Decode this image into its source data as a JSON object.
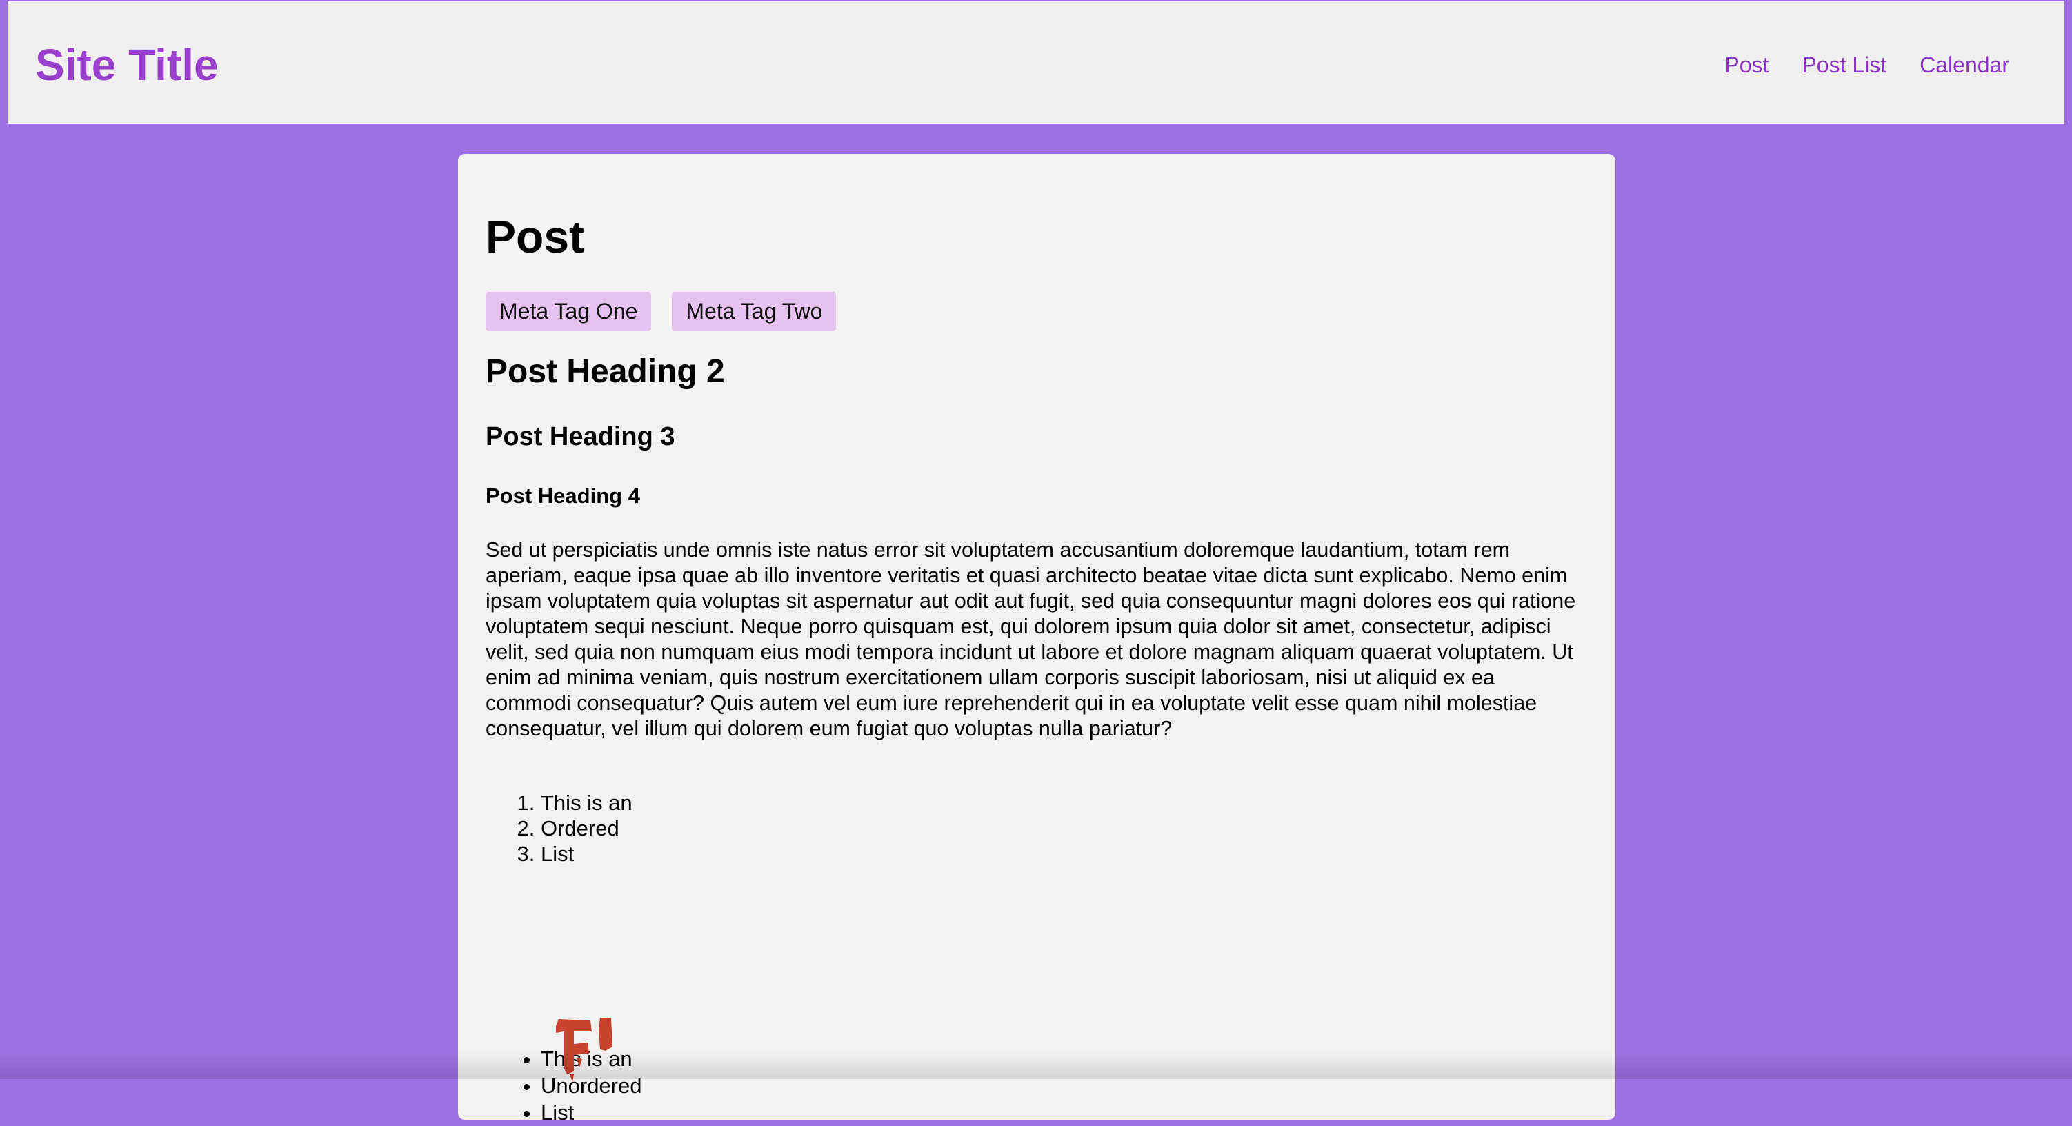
{
  "header": {
    "site_title": "Site Title",
    "nav": [
      "Post",
      "Post List",
      "Calendar"
    ],
    "link_color": "#8d33c8",
    "background": "#f0f0f0"
  },
  "page": {
    "background": "#9e6fe3"
  },
  "post": {
    "title": "Post",
    "tags": [
      "Meta Tag One",
      "Meta Tag Two"
    ],
    "tag_background": "#e6c2f0",
    "heading2": "Post Heading 2",
    "heading3": "Post Heading 3",
    "heading4": "Post Heading 4",
    "paragraph": "Sed ut perspiciatis unde omnis iste natus error sit voluptatem accusantium doloremque laudantium, totam rem aperiam, eaque ipsa quae ab illo inventore veritatis et quasi architecto beatae vitae dicta sunt explicabo. Nemo enim ipsam voluptatem quia voluptas sit aspernatur aut odit aut fugit, sed quia consequuntur magni dolores eos qui ratione voluptatem sequi nesciunt. Neque porro quisquam est, qui dolorem ipsum quia dolor sit amet, consectetur, adipisci velit, sed quia non numquam eius modi tempora incidunt ut labore et dolore magnam aliquam quaerat voluptatem. Ut enim ad minima veniam, quis nostrum exercitationem ullam corporis suscipit laboriosam, nisi ut aliquid ex ea commodi consequatur? Quis autem vel eum iure reprehenderit qui in ea voluptate velit esse quam nihil molestiae consequatur, vel illum qui dolorem eum fugiat quo voluptas nulla pariatur?",
    "ordered_list": [
      "This is an",
      "Ordered",
      "List"
    ],
    "unordered_list": [
      "This is an",
      "Unordered",
      "List"
    ],
    "image_text": "El",
    "image_icon": "painted-logo-image"
  }
}
